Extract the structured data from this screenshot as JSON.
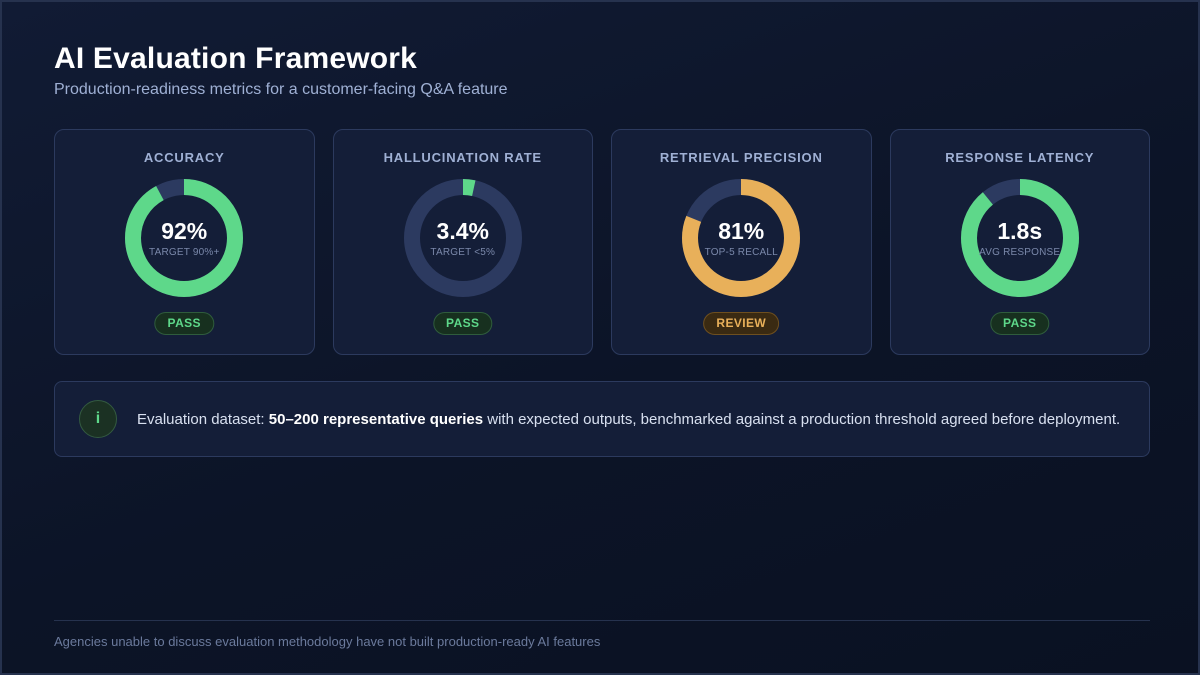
{
  "header": {
    "title": "AI Evaluation Framework",
    "subtitle": "Production-readiness metrics for a customer-facing Q&A feature"
  },
  "colors": {
    "pass": "#5ed88a",
    "review": "#e8b05a",
    "track": "#2c3a60"
  },
  "metrics": [
    {
      "label": "ACCURACY",
      "value": "92%",
      "sub": "TARGET 90%+",
      "fraction": 0.92,
      "status": "PASS",
      "tone": "pass"
    },
    {
      "label": "HALLUCINATION RATE",
      "value": "3.4%",
      "sub": "TARGET <5%",
      "fraction": 0.034,
      "status": "PASS",
      "tone": "pass"
    },
    {
      "label": "RETRIEVAL PRECISION",
      "value": "81%",
      "sub": "TOP-5 RECALL",
      "fraction": 0.81,
      "status": "REVIEW",
      "tone": "review"
    },
    {
      "label": "RESPONSE LATENCY",
      "value": "1.8s",
      "sub": "AVG RESPONSE",
      "fraction": 0.89,
      "status": "PASS",
      "tone": "pass"
    }
  ],
  "info": {
    "icon": "info-icon",
    "glyph": "i",
    "prefix": "Evaluation dataset: ",
    "bold": "50–200 representative queries",
    "suffix": " with expected outputs, benchmarked against a production threshold agreed before deployment."
  },
  "footer": {
    "text": "Agencies unable to discuss evaluation methodology have not built production-ready AI features"
  }
}
